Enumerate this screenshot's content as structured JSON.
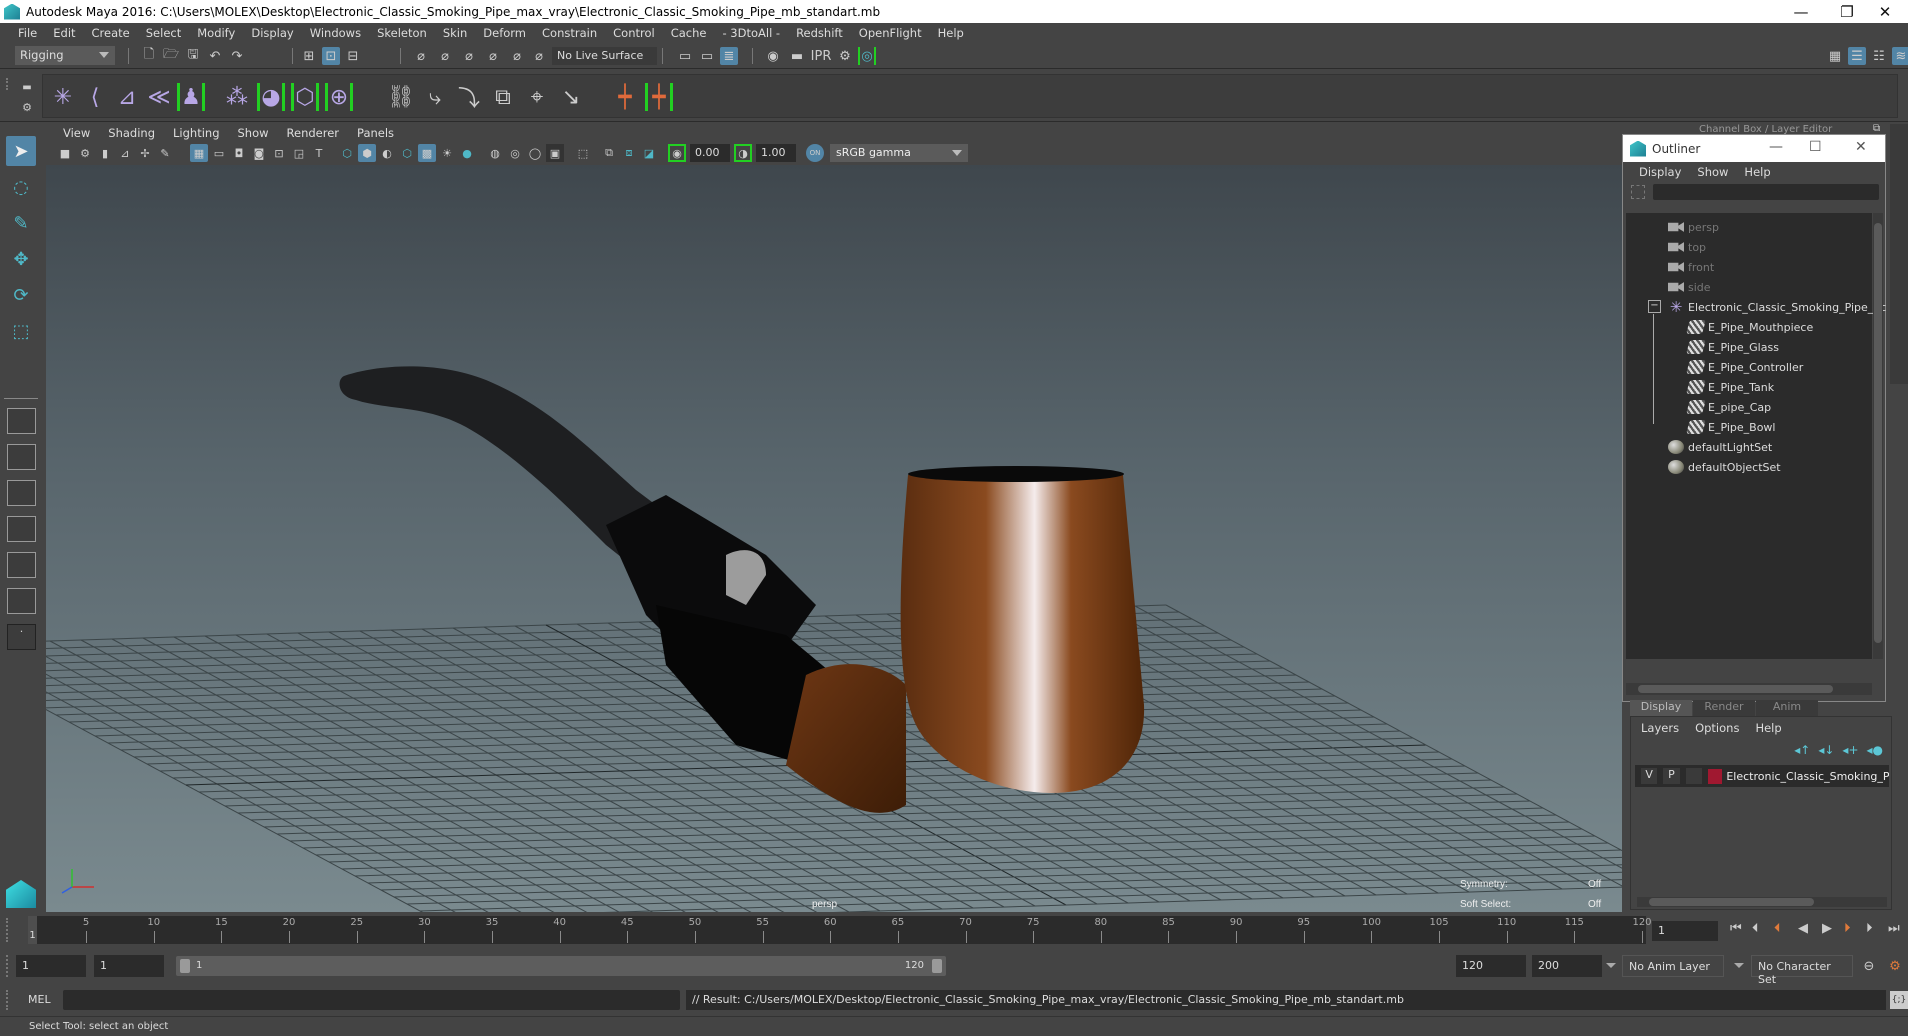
{
  "window": {
    "title": "Autodesk Maya 2016: C:\\Users\\MOLEX\\Desktop\\Electronic_Classic_Smoking_Pipe_max_vray\\Electronic_Classic_Smoking_Pipe_mb_standart.mb",
    "minimize": "—",
    "restore": "❐",
    "close": "✕"
  },
  "menubar": [
    "File",
    "Edit",
    "Create",
    "Select",
    "Modify",
    "Display",
    "Windows",
    "Skeleton",
    "Skin",
    "Deform",
    "Constrain",
    "Control",
    "Cache",
    "- 3DtoAll -",
    "Redshift",
    "OpenFlight",
    "Help"
  ],
  "statusline": {
    "mode": "Rigging",
    "live_surface": "No Live Surface"
  },
  "shelf": {
    "icons": [
      "joint-tool-icon",
      "ik-handle-icon",
      "ik-spline-icon",
      "insert-joint-icon",
      "humanik-icon",
      "paint-weights-icon",
      "smooth-bind-icon",
      "lattice-icon",
      "cluster-icon",
      "parent-constraint-icon",
      "point-constraint-icon",
      "orient-constraint-icon",
      "scale-constraint-icon",
      "aim-constraint-icon",
      "pole-vector-icon",
      "set-key-icon",
      "set-driven-key-icon"
    ]
  },
  "toolbox": {
    "tools": [
      "select-tool-icon",
      "lasso-tool-icon",
      "paint-select-icon",
      "move-tool-icon",
      "rotate-tool-icon",
      "scale-tool-icon"
    ],
    "layouts": [
      "single-perspective-layout",
      "four-view-layout",
      "persp-outliner-layout",
      "persp-graph-layout",
      "persp-hypershade-layout",
      "persp-graph-hypershade-layout",
      "custom-layout"
    ],
    "more": "·"
  },
  "viewport": {
    "menu": [
      "View",
      "Shading",
      "Lighting",
      "Show",
      "Renderer",
      "Panels"
    ],
    "exposure": "0.00",
    "gamma_value": "1.00",
    "color_mgmt_on": "ON",
    "colorspace": "sRGB gamma",
    "camera_label": "persp",
    "hud": {
      "symmetry_label": "Symmetry:",
      "symmetry_value": "Off",
      "soft_select_label": "Soft Select:",
      "soft_select_value": "Off"
    }
  },
  "channel_box_header": "Channel Box / Layer Editor",
  "outliner": {
    "title": "Outliner",
    "menu": [
      "Display",
      "Show",
      "Help"
    ],
    "items": [
      {
        "label": "persp",
        "type": "camera",
        "depth": 0
      },
      {
        "label": "top",
        "type": "camera",
        "depth": 0
      },
      {
        "label": "front",
        "type": "camera",
        "depth": 0
      },
      {
        "label": "side",
        "type": "camera",
        "depth": 0
      },
      {
        "label": "Electronic_Classic_Smoking_Pipe_nc",
        "type": "group",
        "depth": 0,
        "expanded": true
      },
      {
        "label": "E_Pipe_Mouthpiece",
        "type": "mesh",
        "depth": 1
      },
      {
        "label": "E_Pipe_Glass",
        "type": "mesh",
        "depth": 1
      },
      {
        "label": "E_Pipe_Controller",
        "type": "mesh",
        "depth": 1
      },
      {
        "label": "E_Pipe_Tank",
        "type": "mesh",
        "depth": 1
      },
      {
        "label": "E_pipe_Cap",
        "type": "mesh",
        "depth": 1
      },
      {
        "label": "E_Pipe_Bowl",
        "type": "mesh",
        "depth": 1
      },
      {
        "label": "defaultLightSet",
        "type": "set",
        "depth": 0
      },
      {
        "label": "defaultObjectSet",
        "type": "set",
        "depth": 0
      }
    ]
  },
  "layer_editor": {
    "tabs": [
      "Display",
      "Render",
      "Anim"
    ],
    "active_tab": "Display",
    "menu": [
      "Layers",
      "Options",
      "Help"
    ],
    "layers": [
      {
        "visible": "V",
        "playback": "P",
        "color": "#a01830",
        "name": "Electronic_Classic_Smoking_Pipe"
      }
    ]
  },
  "timeline": {
    "start": 1,
    "end": 120,
    "current_frame": "1",
    "tick_labels": [
      5,
      10,
      15,
      20,
      25,
      30,
      35,
      40,
      45,
      50,
      55,
      60,
      65,
      70,
      75,
      80,
      85,
      90,
      95,
      100,
      105,
      110,
      115,
      120
    ]
  },
  "range": {
    "start_field": "1",
    "playback_start": "1",
    "slider_start": "1",
    "slider_end": "120",
    "playback_end": "120",
    "end_field": "200",
    "anim_layer": "No Anim Layer",
    "character_set": "No Character Set"
  },
  "cmdline": {
    "label": "MEL",
    "result": "// Result: C:/Users/MOLEX/Desktop/Electronic_Classic_Smoking_Pipe_max_vray/Electronic_Classic_Smoking_Pipe_mb_standart.mb"
  },
  "helpline": "Select Tool: select an object",
  "colors": {
    "accent_blue": "#5285a6",
    "bracket_green": "#22d022",
    "shelf_purple": "#b8a7e6",
    "key_orange": "#e06a3b",
    "layer_red": "#a01830"
  }
}
